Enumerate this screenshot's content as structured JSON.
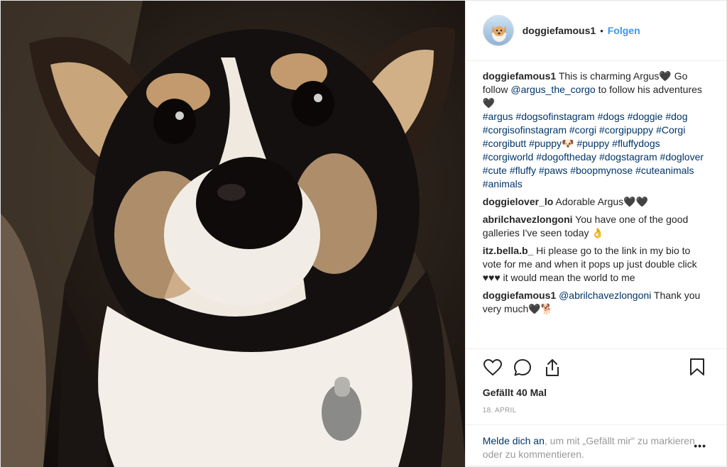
{
  "header": {
    "username": "doggiefamous1",
    "separator": "•",
    "follow_label": "Folgen"
  },
  "caption": {
    "username": "doggiefamous1",
    "text_1": "This is charming Argus🖤 Go follow",
    "mention": "@argus_the_corgo",
    "text_2": "to follow his adventures🖤",
    "hashtags": "#argus #dogsofinstagram #dogs #doggie #dog #corgisofinstagram #corgi #corgipuppy #Corgi #corgibutt #puppy🐶 #puppy #fluffydogs #corgiworld #dogoftheday #dogstagram #doglover #cute #fluffy #paws #boopmynose #cuteanimals #animals"
  },
  "comments": [
    {
      "username": "doggielover_lo",
      "text": "Adorable Argus🖤🖤"
    },
    {
      "username": "abrilchavezlongoni",
      "text": "You have one of the good galleries I've seen today 👌"
    },
    {
      "username": "itz.bella.b_",
      "text": " Hi please go to the link in my bio to vote for me and when it pops up just double click ♥♥♥ it would mean the world to me"
    },
    {
      "username": "doggiefamous1",
      "mention": "@abrilchavezlongoni",
      "text": "Thank you very much🖤🐕"
    }
  ],
  "actions": {
    "like_icon": "heart-icon",
    "comment_icon": "comment-bubble-icon",
    "share_icon": "share-icon",
    "save_icon": "bookmark-icon"
  },
  "likes_label": "Gefällt 40 Mal",
  "date_label": "18. APRIL",
  "login": {
    "link_text": "Melde dich an",
    "rest_text": ", um mit „Gefällt mir\" zu markieren oder zu kommentieren.",
    "more_label": "•••"
  },
  "colors": {
    "accent": "#3897f0",
    "link": "#003569",
    "muted": "#999999"
  }
}
